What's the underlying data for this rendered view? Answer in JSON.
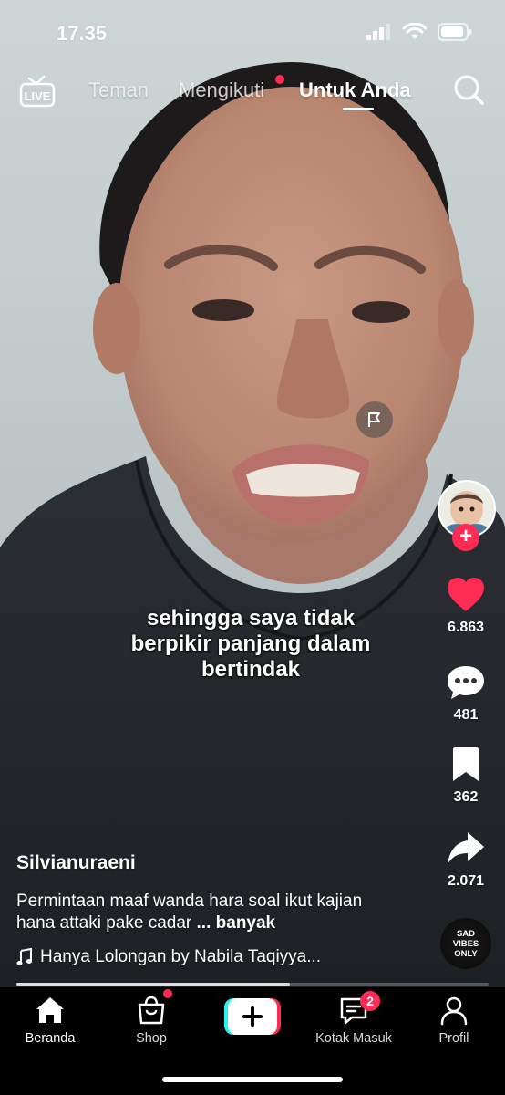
{
  "status_bar": {
    "time": "17.35"
  },
  "top_nav": {
    "live_label": "LIVE",
    "tabs": [
      {
        "label": "Teman",
        "active": false
      },
      {
        "label": "Mengikuti",
        "active": false,
        "has_dot": true
      },
      {
        "label": "Untuk Anda",
        "active": true
      }
    ]
  },
  "video": {
    "caption_lines": [
      "sehingga saya tidak",
      "berpikir panjang dalam",
      "bertindak"
    ],
    "username": "Silvianuraeni",
    "description": "Permintaan maaf wanda hara soal ikut kajian hana attaki pake cadar",
    "description_more": "... banyak",
    "music": "Hanya Lolongan by Nabila Taqiyya...",
    "progress_fraction": 0.58
  },
  "actions": {
    "likes": "6.863",
    "comments": "481",
    "saves": "362",
    "shares": "2.071"
  },
  "music_disc": {
    "text_lines": [
      "SAD",
      "VIBES",
      "ONLY"
    ]
  },
  "bottom_nav": {
    "items": [
      {
        "label": "Beranda",
        "active": true
      },
      {
        "label": "Shop",
        "active": false
      },
      {
        "label": "Kotak Masuk",
        "active": false,
        "badge": "2"
      },
      {
        "label": "Profil",
        "active": false
      }
    ]
  },
  "colors": {
    "accent": "#fe2c55",
    "create_cyan": "#25f4ee"
  }
}
